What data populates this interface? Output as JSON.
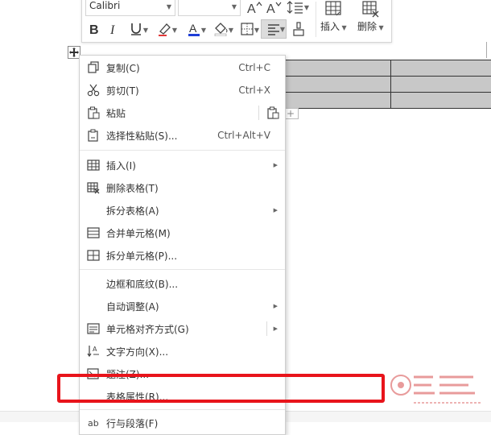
{
  "toolbar": {
    "font_name": "Calibri",
    "font_size": "",
    "insert_label": "插入",
    "delete_label": "删除"
  },
  "add_row_symbol": "+",
  "menu": {
    "copy": {
      "label": "复制(C)",
      "shortcut": "Ctrl+C"
    },
    "cut": {
      "label": "剪切(T)",
      "shortcut": "Ctrl+X"
    },
    "paste": {
      "label": "粘贴"
    },
    "paste_special": {
      "label": "选择性粘贴(S)...",
      "shortcut": "Ctrl+Alt+V"
    },
    "insert": {
      "label": "插入(I)"
    },
    "delete_table": {
      "label": "删除表格(T)"
    },
    "split_table": {
      "label": "拆分表格(A)"
    },
    "merge_cells": {
      "label": "合并单元格(M)"
    },
    "split_cells": {
      "label": "拆分单元格(P)..."
    },
    "borders_shading": {
      "label": "边框和底纹(B)..."
    },
    "autofit": {
      "label": "自动调整(A)"
    },
    "cell_alignment": {
      "label": "单元格对齐方式(G)"
    },
    "text_direction": {
      "label": "文字方向(X)..."
    },
    "caption": {
      "label": "题注(Z)..."
    },
    "table_properties": {
      "label": "表格属性(R)..."
    },
    "partial_item": {
      "label": "行与段落(F)"
    }
  },
  "colors": {
    "highlight_border": "#e8141b",
    "table_fill": "#c8c8c8",
    "font_color_bar": "#1f3fd8"
  }
}
